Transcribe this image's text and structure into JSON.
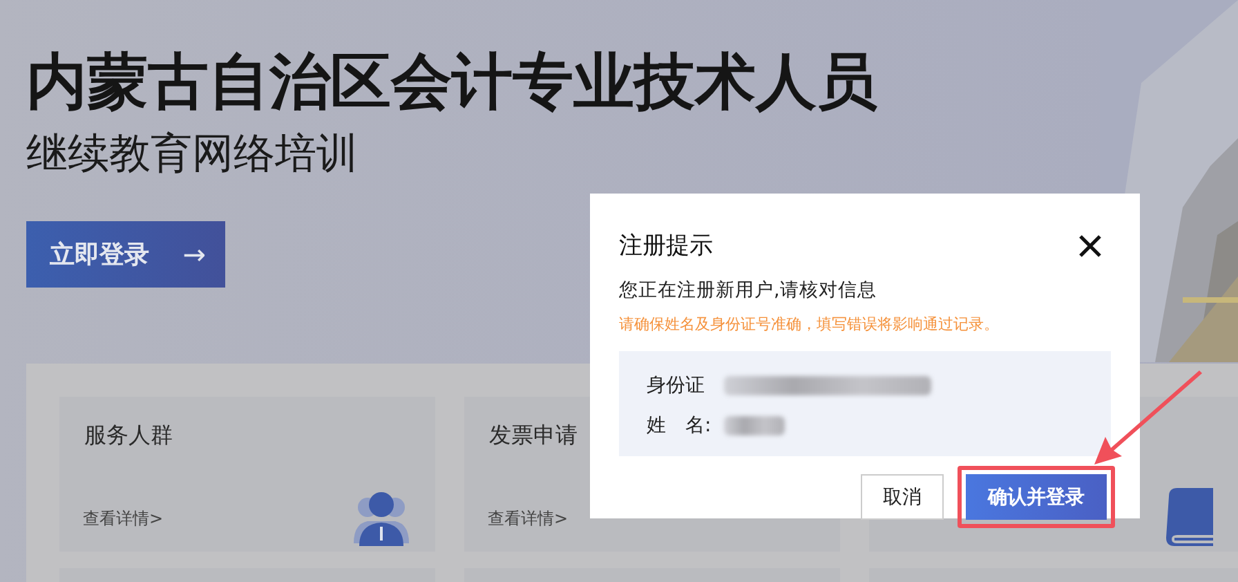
{
  "hero": {
    "title": "内蒙古自治区会计专业技术人员",
    "subtitle": "继续教育网络培训",
    "login_button": "立即登录",
    "login_arrow": "→"
  },
  "cards": [
    {
      "kind": "people",
      "title": "服务人群",
      "link": "查看详情>"
    },
    {
      "kind": "plain",
      "title": "发票申请",
      "link": "查看详情>"
    },
    {
      "kind": "book"
    }
  ],
  "dialog": {
    "title": "注册提示",
    "message": "您正在注册新用户,请核对信息",
    "warning": "请确保姓名及身份证号准确，填写错误将影响通过记录。",
    "fields": [
      {
        "label": "身份证",
        "redacted": true
      },
      {
        "label": "姓　名:",
        "redacted": true
      }
    ],
    "buttons": [
      {
        "label": "取消",
        "kind": "secondary",
        "highlighted": false
      },
      {
        "label": "确认并登录",
        "kind": "primary",
        "highlighted": true
      }
    ]
  }
}
